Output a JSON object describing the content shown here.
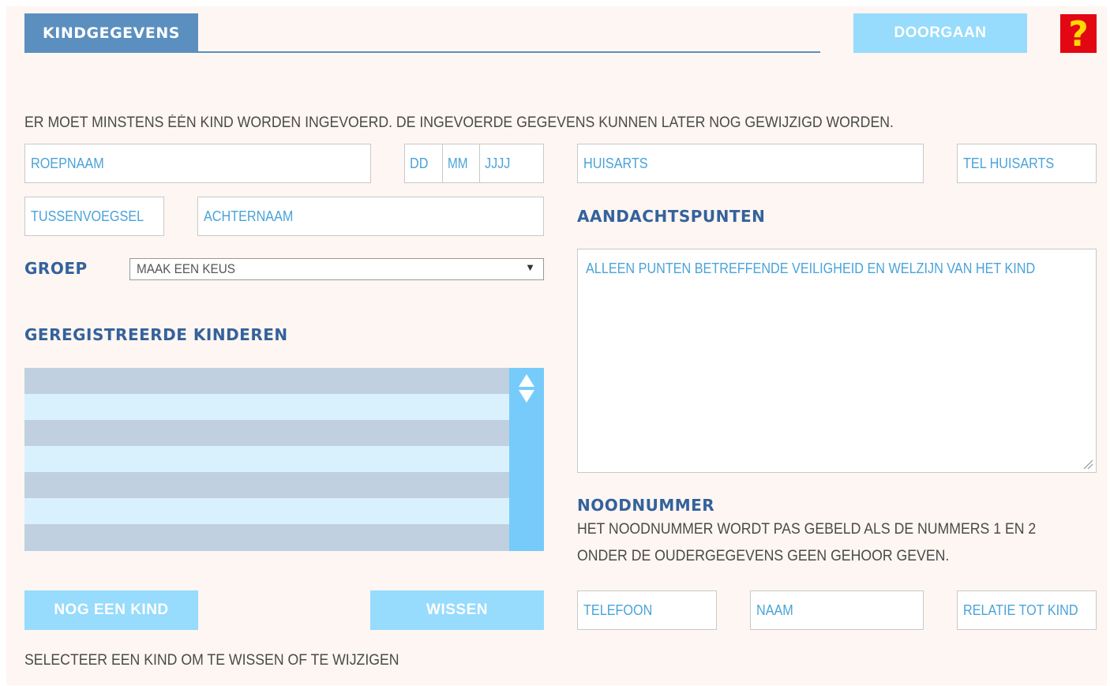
{
  "header": {
    "tab_label": "KINDGEGEVENS",
    "continue_label": "DOORGAAN",
    "help_symbol": "?"
  },
  "intro_text": "ER MOET MINSTENS ÉÉN KIND WORDEN INGEVOERD. DE INGEVOERDE GEGEVENS KUNNEN LATER NOG GEWIJZIGD WORDEN.",
  "child_form": {
    "first_name_placeholder": "ROEPNAAM",
    "birth_day_placeholder": "DD",
    "birth_month_placeholder": "MM",
    "birth_year_placeholder": "JJJJ",
    "prefix_placeholder": "TUSSENVOEGSEL",
    "last_name_placeholder": "ACHTERNAAM",
    "group_label": "GROEP",
    "group_selected": "MAAK EEN KEUS"
  },
  "registered": {
    "heading": "GEREGISTREERDE KINDEREN",
    "rows": [
      "",
      "",
      "",
      "",
      "",
      "",
      ""
    ]
  },
  "actions": {
    "add_label": "NOG EEN KIND",
    "delete_label": "WISSEN",
    "hint": "SELECTEER EEN KIND OM TE WISSEN OF TE WIJZIGEN"
  },
  "doctor": {
    "name_placeholder": "HUISARTS",
    "phone_placeholder": "TEL HUISARTS"
  },
  "attention": {
    "heading": "AANDACHTSPUNTEN",
    "placeholder": "ALLEEN PUNTEN BETREFFENDE VEILIGHEID EN WELZIJN VAN HET KIND"
  },
  "emergency": {
    "heading": "NOODNUMMER",
    "line1": "HET NOODNUMMER WORDT PAS GEBELD ALS DE NUMMERS 1 EN 2",
    "line2": "ONDER DE OUDERGEGEVENS GEEN GEHOOR GEVEN.",
    "phone_placeholder": "TELEFOON",
    "name_placeholder": "NAAM",
    "relation_placeholder": "RELATIE TOT KIND"
  },
  "colors": {
    "accent": "#5b8fbf",
    "heading": "#34629c",
    "button": "#97dbfd",
    "help": "#e30613",
    "help_mark": "#ffd800"
  }
}
